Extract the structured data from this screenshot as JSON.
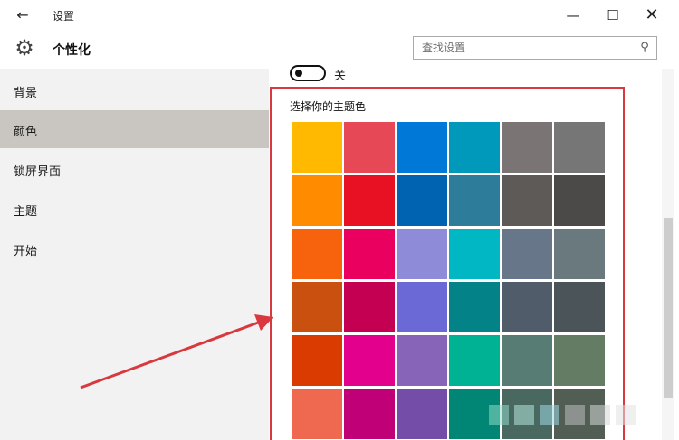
{
  "window": {
    "title": "设置",
    "back_icon": "←",
    "minimize_icon": "—",
    "maximize_icon": "☐",
    "close_icon": "✕"
  },
  "header": {
    "page_title": "个性化",
    "gear_icon": "⚙",
    "search_placeholder": "查找设置",
    "search_icon": "⚲"
  },
  "sidebar": {
    "items": [
      {
        "label": "背景",
        "active": false
      },
      {
        "label": "颜色",
        "active": true
      },
      {
        "label": "锁屏界面",
        "active": false
      },
      {
        "label": "主题",
        "active": false
      },
      {
        "label": "开始",
        "active": false
      }
    ]
  },
  "content": {
    "toggle_label": "关",
    "toggle_state": "off",
    "section_title": "选择你的主题色",
    "swatches": [
      "#ffb900",
      "#e74856",
      "#0078d7",
      "#0099bc",
      "#7a7574",
      "#767676",
      "#ff8c00",
      "#e81123",
      "#0063b1",
      "#2d7d9a",
      "#5d5a58",
      "#4c4a48",
      "#f7630c",
      "#ea005e",
      "#8e8cd8",
      "#00b7c3",
      "#68768a",
      "#69797e",
      "#ca5010",
      "#c30052",
      "#6b69d6",
      "#038387",
      "#515c6b",
      "#4a5459",
      "#da3b01",
      "#e3008c",
      "#8764b8",
      "#00b294",
      "#567c73",
      "#647c64",
      "#ef6950",
      "#bf0077",
      "#744da9",
      "#018574",
      "#486860",
      "#525e54"
    ]
  },
  "colors": {
    "highlight": "#d9383e",
    "sidebar_bg": "#f2f2f2",
    "sidebar_active": "#c9c6c1",
    "arrow": "#d9383e"
  }
}
